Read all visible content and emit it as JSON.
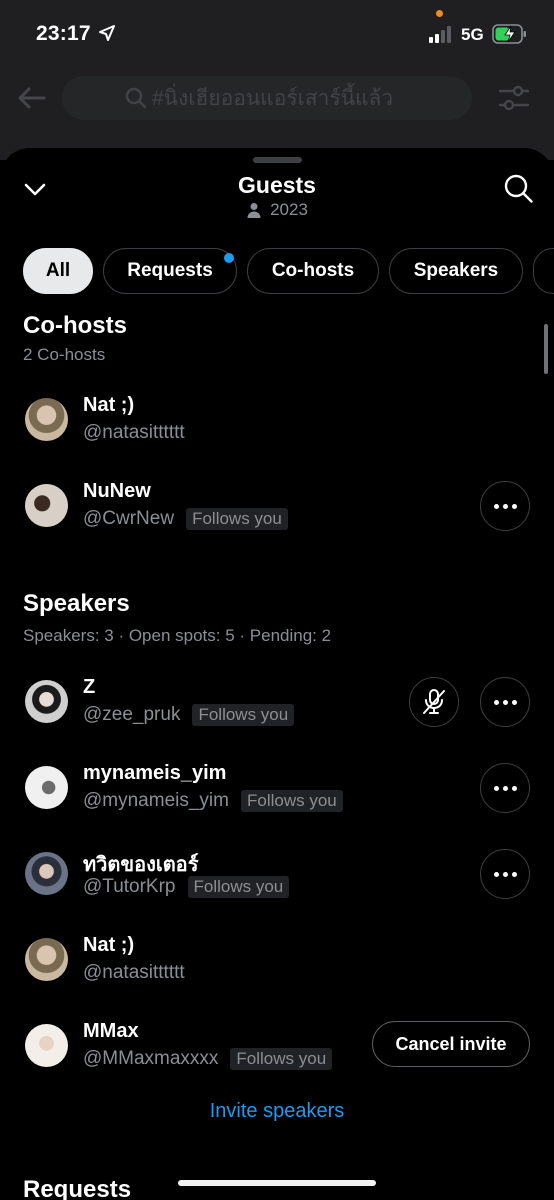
{
  "status_bar": {
    "time": "23:17",
    "network": "5G",
    "colors": {
      "charging": "#30d158",
      "privacy_dot": "#f08a24"
    }
  },
  "background_page": {
    "search_text": "#นิ่งเฮียออนแอร์เสาร์นี้แล้ว"
  },
  "sheet": {
    "title": "Guests",
    "listener_count": "2023",
    "tabs": [
      {
        "label": "All",
        "active": true
      },
      {
        "label": "Requests",
        "active": false,
        "has_badge": true
      },
      {
        "label": "Co-hosts",
        "active": false
      },
      {
        "label": "Speakers",
        "active": false
      }
    ],
    "accent_color": "#1d9bf0"
  },
  "cohosts": {
    "title": "Co-hosts",
    "subtitle": "2 Co-hosts",
    "users": [
      {
        "name": "Nat ;)",
        "handle": "@natasitttttt",
        "follows_you": ""
      },
      {
        "name": "NuNew",
        "handle": "@CwrNew",
        "follows_you": "Follows you"
      }
    ]
  },
  "speakers": {
    "title": "Speakers",
    "subtitle": "Speakers: 3 · Open spots: 5 · Pending: 2",
    "users": [
      {
        "name": "Z",
        "handle": "@zee_pruk",
        "follows_you": "Follows you",
        "muted": true
      },
      {
        "name": "mynameis_yim",
        "handle": "@mynameis_yim",
        "follows_you": "Follows you"
      },
      {
        "name": "ทวิตของเตอร์",
        "handle": "@TutorKrp",
        "follows_you": "Follows you"
      },
      {
        "name": "Nat ;)",
        "handle": "@natasitttttt",
        "follows_you": ""
      },
      {
        "name": "MMax",
        "handle": "@MMaxmaxxxx",
        "follows_you": "Follows you",
        "action": "Cancel invite"
      }
    ],
    "invite_label": "Invite speakers"
  },
  "next_section_title": "Requests"
}
